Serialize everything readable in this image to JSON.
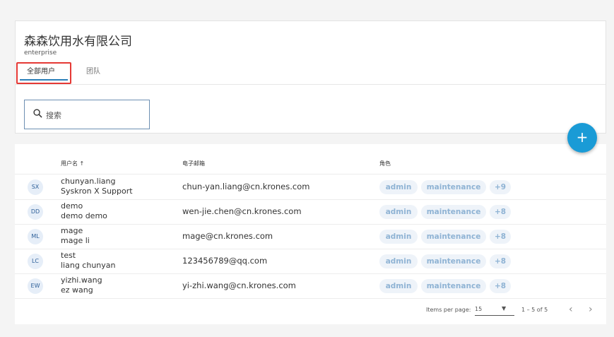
{
  "org": {
    "title": "森森饮用水有限公司",
    "subtitle": "enterprise"
  },
  "tabs": [
    {
      "label": "全部用户"
    },
    {
      "label": "团队"
    }
  ],
  "search": {
    "placeholder": "搜索",
    "icon": "search-icon"
  },
  "fab": {
    "label": "+"
  },
  "table": {
    "headers": {
      "user": "用户名 ↑",
      "email": "电子邮箱",
      "role": "角色"
    },
    "rows": [
      {
        "initials": "SX",
        "username": "chunyan.liang",
        "fullname": "Syskron X Support",
        "email": "chun-yan.liang@cn.krones.com",
        "roles": [
          "admin",
          "maintenance"
        ],
        "more": "+9"
      },
      {
        "initials": "DD",
        "username": "demo",
        "fullname": "demo demo",
        "email": "wen-jie.chen@cn.krones.com",
        "roles": [
          "admin",
          "maintenance"
        ],
        "more": "+8"
      },
      {
        "initials": "ML",
        "username": "mage",
        "fullname": "mage li",
        "email": "mage@cn.krones.com",
        "roles": [
          "admin",
          "maintenance"
        ],
        "more": "+8"
      },
      {
        "initials": "LC",
        "username": "test",
        "fullname": "liang chunyan",
        "email": "123456789@qq.com",
        "roles": [
          "admin",
          "maintenance"
        ],
        "more": "+8"
      },
      {
        "initials": "EW",
        "username": "yizhi.wang",
        "fullname": "ez wang",
        "email": "yi-zhi.wang@cn.krones.com",
        "roles": [
          "admin",
          "maintenance"
        ],
        "more": "+8"
      }
    ]
  },
  "pagination": {
    "label": "Items per page:",
    "value": "15",
    "range": "1 – 5 of 5",
    "prev": "‹",
    "next": "›"
  },
  "colors": {
    "accent": "#1a9bd6",
    "highlight": "#e53935",
    "tab_underline": "#2a7fb8"
  }
}
